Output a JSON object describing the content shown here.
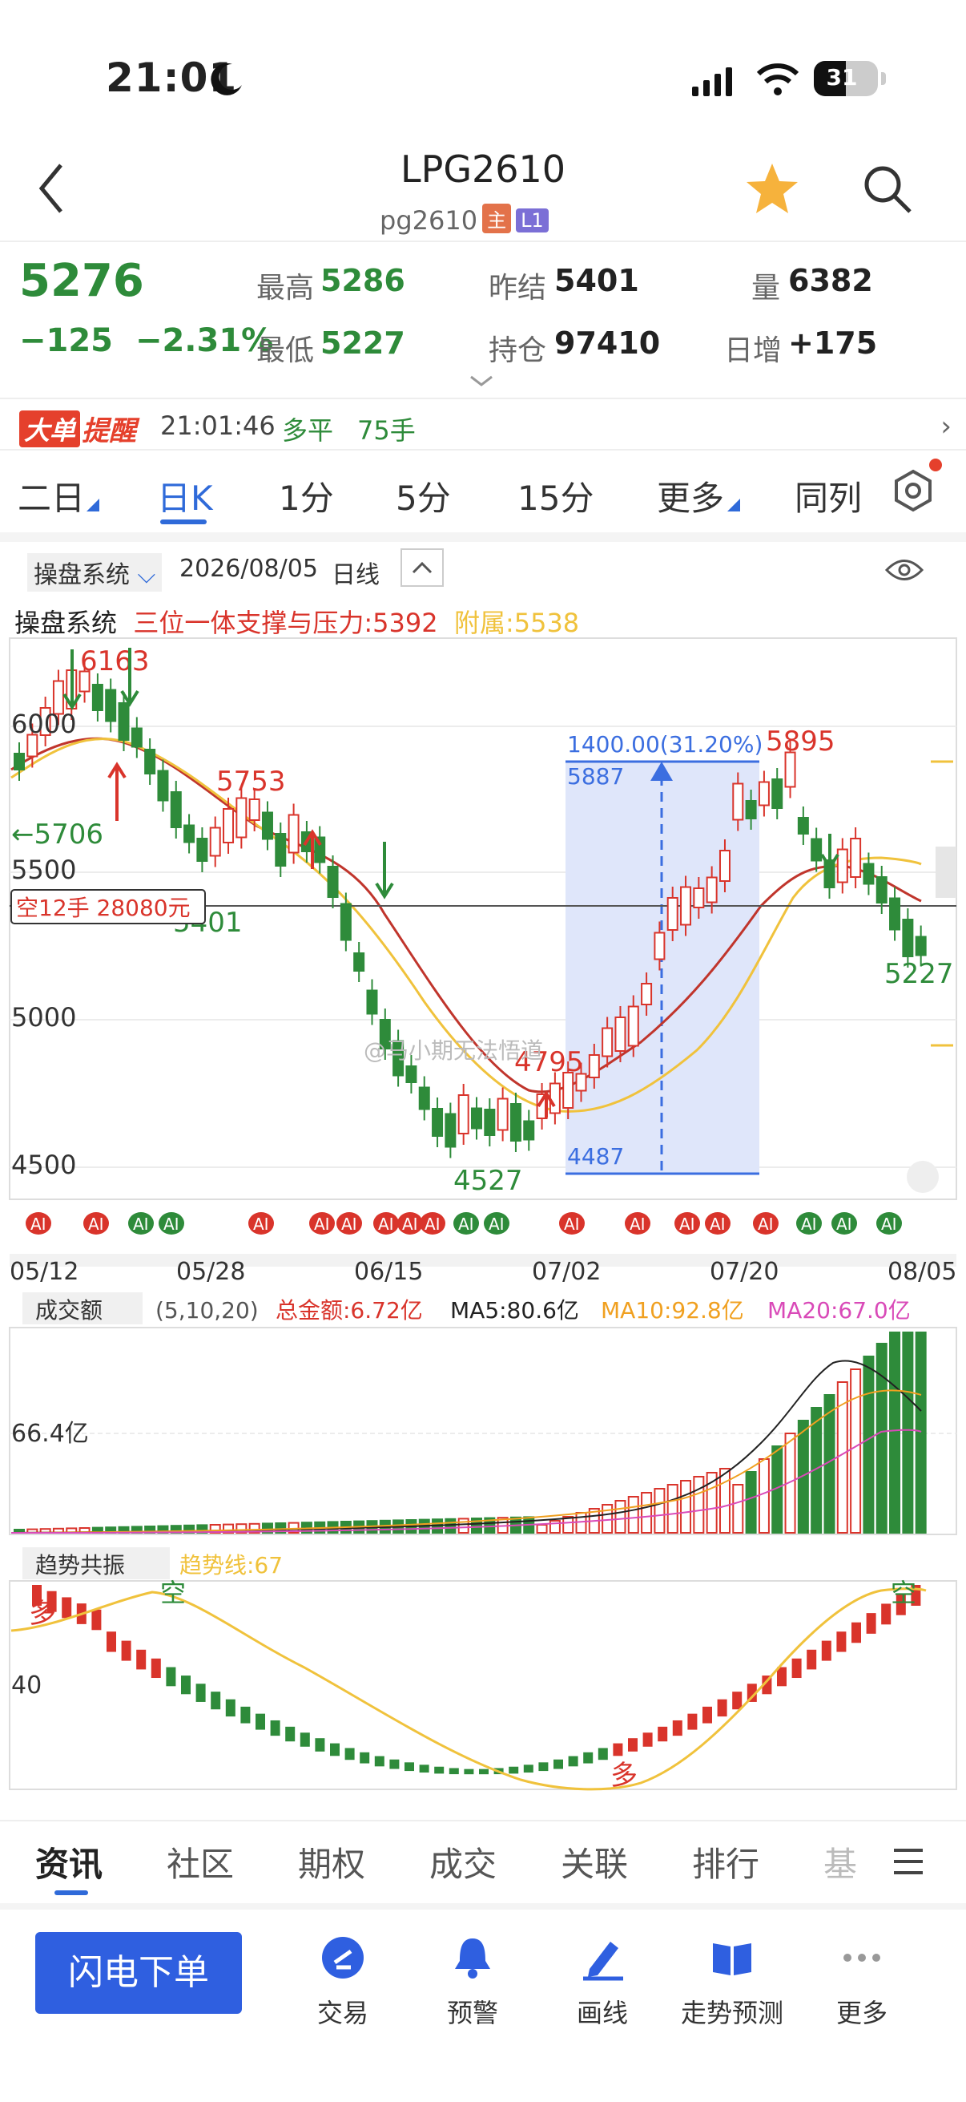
{
  "status": {
    "time": "21:01",
    "battery": "31"
  },
  "header": {
    "title": "LPG2610",
    "code": "pg2610",
    "tag_main": "主",
    "tag_level": "L1"
  },
  "quote": {
    "price": "5276",
    "change": "−125",
    "change_pct": "−2.31%",
    "high_label": "最高",
    "high": "5286",
    "low_label": "最低",
    "low": "5227",
    "prev_settle_label": "昨结",
    "prev_settle": "5401",
    "open_int_label": "持仓",
    "open_int": "97410",
    "volume_label": "量",
    "volume": "6382",
    "daily_inc_label": "日增",
    "daily_inc": "+175"
  },
  "alert": {
    "tag": "大单",
    "title": "提醒",
    "time": "21:01:46",
    "action": "多平",
    "lots": "75手"
  },
  "tabs": [
    "二日",
    "日K",
    "1分",
    "5分",
    "15分",
    "更多",
    "同列"
  ],
  "system_row": {
    "system": "操盘系统",
    "date": "2026/08/05",
    "period": "日线"
  },
  "indicator": {
    "name": "操盘系统",
    "pressure": "三位一体支撑与压力:5392",
    "sub": "附属:5538"
  },
  "main_chart": {
    "y_ticks": [
      "6000",
      "5500",
      "5000",
      "4500"
    ],
    "x_labels": [
      "05/12",
      "05/28",
      "06/15",
      "07/02",
      "07/20",
      "08/05"
    ],
    "labels": {
      "high1": "6163",
      "p5753": "5753",
      "p5706": "←5706",
      "p5401": "5401",
      "p4795": "4795",
      "p4527": "4527",
      "p5895": "5895",
      "p5227": "5227"
    },
    "measure_top": "1400.00(31.20%)",
    "measure_hi": "5887",
    "measure_lo": "4487",
    "short_pos": "空12手 28080元",
    "watermark": "@马小期无法悟道"
  },
  "volume_panel": {
    "name": "成交额",
    "params": "(5,10,20)",
    "total": "总金额:6.72亿",
    "ma5": "MA5:80.6亿",
    "ma10": "MA10:92.8亿",
    "ma20": "MA20:67.0亿",
    "level": "66.4亿"
  },
  "trend_panel": {
    "name": "趋势共振",
    "line": "趋势线:67",
    "level": "40",
    "duo": "多",
    "kong": "空"
  },
  "bottom_tabs": [
    "资讯",
    "社区",
    "期权",
    "成交",
    "关联",
    "排行",
    "基"
  ],
  "footer": {
    "flash": "闪电下单",
    "items": [
      "交易",
      "预警",
      "画线",
      "走势预测",
      "更多"
    ]
  },
  "ai_tag": "AI",
  "colors": {
    "up": "#d9342b",
    "down": "#2e8b3a",
    "accent": "#2f6ad9"
  }
}
